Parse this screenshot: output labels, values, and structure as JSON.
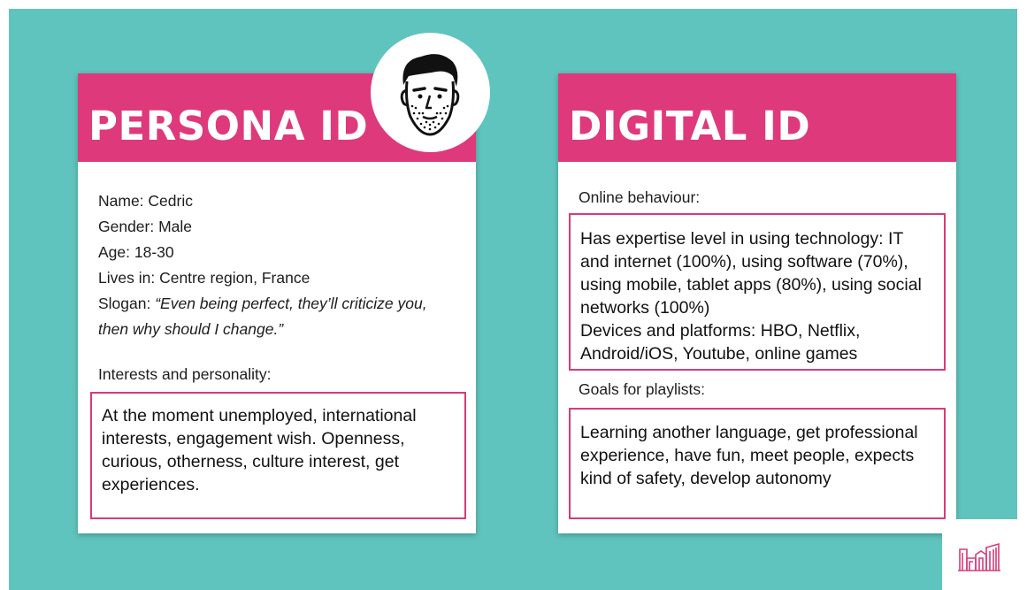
{
  "persona": {
    "title": "PERSONA ID",
    "name_label": "Name:",
    "name_value": "Cedric",
    "gender_label": "Gender:",
    "gender_value": "Male",
    "age_label": "Age:",
    "age_value": "18-30",
    "lives_label": "Lives in:",
    "lives_value": "Centre region, France",
    "slogan_label": "Slogan:",
    "slogan_value": "“Even being perfect, they’ll criticize you, then why should I change.”",
    "interests_label": "Interests and personality:",
    "interests_text": "At the moment unemployed, international interests, engagement wish. Openness, curious, otherness, culture interest, get experiences.",
    "avatar_icon": "bearded-man-avatar-icon"
  },
  "digital": {
    "title": "DIGITAL ID",
    "online_label": "Online behaviour:",
    "online_text": "Has expertise level in using technology: IT and internet (100%), using software (70%), using mobile, tablet apps (80%), using social networks (100%)",
    "devices_text": "Devices and platforms: HBO, Netflix, Android/iOS, Youtube, online games",
    "goals_label": "Goals for playlists:",
    "goals_text": "Learning another language, get professional experience, have fun, meet people, expects kind of safety, develop autonomy"
  },
  "logo": {
    "icon": "city-skyline-logo-icon"
  },
  "colors": {
    "background": "#5fc4bd",
    "accent": "#de3a7b",
    "card": "#ffffff",
    "text": "#1d1d1d"
  }
}
